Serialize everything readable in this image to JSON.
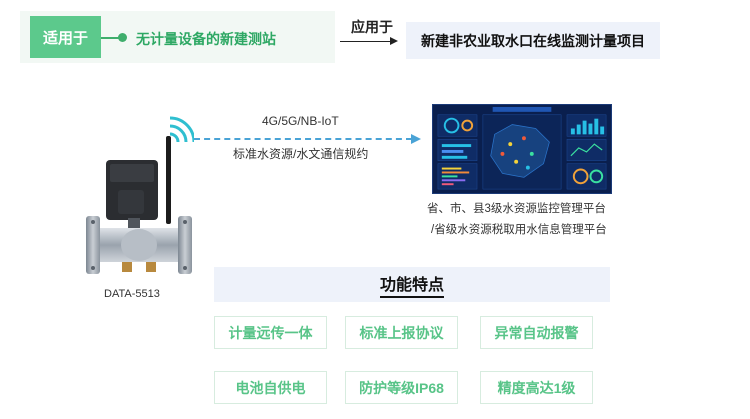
{
  "applicable": {
    "tag": "适用于",
    "text": "无计量设备的新建测站"
  },
  "applied": {
    "label": "应用于",
    "project": "新建非农业取水口在线监测计量项目"
  },
  "device": {
    "name": "DATA-5513"
  },
  "communication": {
    "protocol_line_1": "4G/5G/NB-IoT",
    "protocol_line_2": "标准水资源/水文通信规约"
  },
  "platform": {
    "line_1": "省、市、县3级水资源监控管理平台",
    "line_2": "/省级水资源税取用水信息管理平台"
  },
  "features": {
    "title": "功能特点",
    "items": [
      "计量远传一体",
      "标准上报协议",
      "异常自动报警",
      "电池自供电",
      "防护等级IP68",
      "精度高达1级"
    ]
  },
  "colors": {
    "accent_green": "#5cc98c",
    "link_blue": "#4aa3d6",
    "dashboard_bg": "#0a1f4e"
  },
  "icons": [
    "wifi-signal-icon",
    "arrow-right-icon"
  ]
}
